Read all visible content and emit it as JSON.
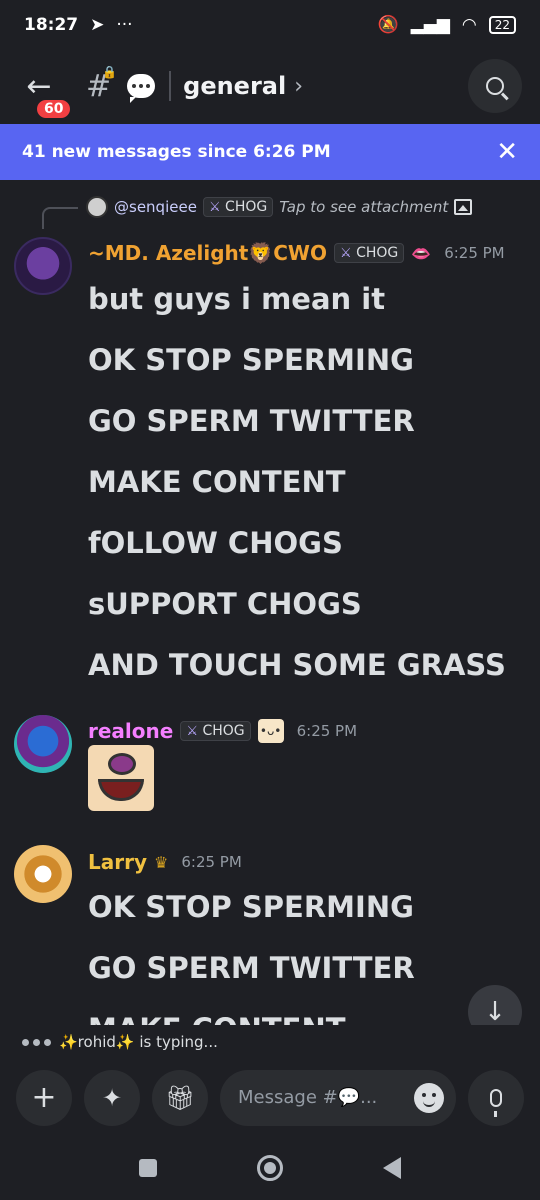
{
  "status_bar": {
    "time": "18:27",
    "battery": "22"
  },
  "header": {
    "unread_badge": "60",
    "channel_name": "general"
  },
  "new_messages_bar": {
    "text": "41 new messages since 6:26 PM"
  },
  "reply": {
    "mention": "@senqieee",
    "role_tag": "CHOG",
    "hint": "Tap to see attachment"
  },
  "messages": [
    {
      "author": "~MD. Azelight🦁CWO",
      "author_color": "#f0a232",
      "role_tag": "CHOG",
      "timestamp": "6:25 PM",
      "lines": [
        "but guys i mean it",
        "OK STOP SPERMING",
        "GO SPERM TWITTER",
        "MAKE CONTENT",
        "fOLLOW CHOGS",
        "sUPPORT CHOGS",
        "AND TOUCH SOME GRASS"
      ]
    },
    {
      "author": "realone",
      "author_color": "#f47fff",
      "role_tag": "CHOG",
      "timestamp": "6:25 PM"
    },
    {
      "author": "Larry",
      "author_color": "#f0c040",
      "timestamp": "6:25 PM",
      "lines": [
        "OK STOP SPERMING",
        "GO SPERM TWITTER",
        "MAKE CONTENT"
      ]
    }
  ],
  "typing": {
    "text": "✨rohid✨ is typing..."
  },
  "composer": {
    "placeholder": "Message #💬..."
  }
}
